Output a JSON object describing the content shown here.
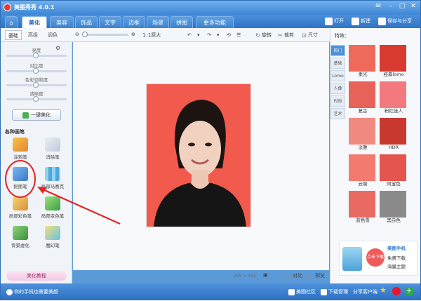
{
  "title": "美图秀秀 4.0.1",
  "tabs": [
    "美化",
    "美容",
    "饰品",
    "文字",
    "边框",
    "场景",
    "拼图",
    "更多功能"
  ],
  "active_tab": "美化",
  "header_actions": {
    "open": "打开",
    "new": "新建",
    "save": "保存与分享"
  },
  "subtabs": [
    "基础",
    "高级",
    "调色"
  ],
  "toolbar": {
    "actual_size": "原大",
    "rotate": "旋转",
    "crop": "裁剪",
    "resize": "尺寸"
  },
  "adjustments": [
    "亮度",
    "对比度",
    "色彩饱和度",
    "清晰度"
  ],
  "one_click": "一键美化",
  "brush_heading": "各种画笔",
  "brushes": [
    "涂鸦笔",
    "消除笔",
    "抠图笔",
    "局部马赛克",
    "局部彩色笔",
    "局部变色笔",
    "背景虚化",
    "魔幻笔"
  ],
  "tutorial": "美化教程",
  "status": {
    "size": "255 × 351",
    "compare": "对比",
    "preview": "预览"
  },
  "effects_title": "特效：",
  "effect_tabs": [
    "热门",
    "基础",
    "Lomo",
    "人像",
    "时尚",
    "艺术"
  ],
  "effects": [
    "柔光",
    "经典lomo",
    "复古",
    "粉红佳人",
    "淡雅",
    "HDR",
    "云端",
    "阿宝色",
    "蓝色雪",
    "黑白色"
  ],
  "ad": {
    "badge": "点击下载",
    "title": "美图手机",
    "line1": "免费下载",
    "line2": "海量主题"
  },
  "statusbar": {
    "tip": "你的手机也需要美颜",
    "bbs": "美图社区",
    "download": "下载管理",
    "share": "分享客户端"
  },
  "colors": {
    "accent": "#3e86d6",
    "photo_bg": "#f25a4e",
    "annotation": "#e52424"
  }
}
